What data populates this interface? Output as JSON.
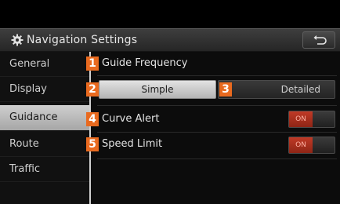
{
  "header": {
    "title": "Navigation Settings",
    "back_icon": "back-arrow-icon",
    "gear_icon": "gear-icon"
  },
  "sidebar": {
    "items": [
      {
        "label": "General",
        "active": false
      },
      {
        "label": "Display",
        "active": false
      },
      {
        "label": "Guidance",
        "active": true
      },
      {
        "label": "Route",
        "active": false
      },
      {
        "label": "Traffic",
        "active": false
      }
    ]
  },
  "guidance": {
    "frequency": {
      "badge": "1",
      "label": "Guide Frequency",
      "options": [
        {
          "badge": "2",
          "label": "Simple",
          "selected": true
        },
        {
          "badge": "3",
          "label": "Detailed",
          "selected": false
        }
      ]
    },
    "curve_alert": {
      "badge": "4",
      "label": "Curve Alert",
      "toggle": "ON"
    },
    "speed_limit": {
      "badge": "5",
      "label": "Speed Limit",
      "toggle": "ON"
    }
  },
  "colors": {
    "badge": "#e96a1f",
    "toggle_on": "#b03422",
    "active_tab": "#c4c4c4"
  }
}
